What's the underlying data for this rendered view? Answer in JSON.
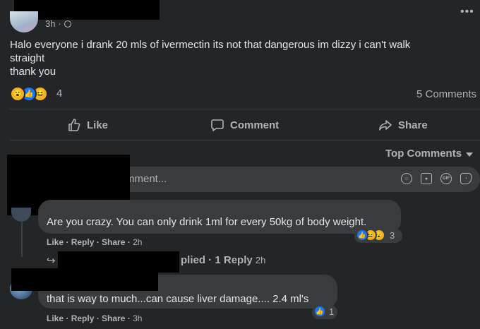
{
  "post": {
    "time": "3h",
    "privacy_icon": "globe-icon",
    "text_lines": [
      "Halo everyone i drank 20 mls of ivermectin its not that dangerous im dizzy i can't walk",
      "straight",
      "thank you"
    ],
    "reaction_count": "4",
    "comments_count": "5 Comments",
    "reactions": [
      "wow",
      "like",
      "haha"
    ]
  },
  "actions": {
    "like": "Like",
    "comment": "Comment",
    "share": "Share"
  },
  "sort": {
    "label": "Top Comments"
  },
  "composer": {
    "placeholder_visible": "mment...",
    "icons": [
      "emoji-icon",
      "camera-icon",
      "gif-icon",
      "sticker-icon"
    ]
  },
  "comments": [
    {
      "text": "Are you crazy. You can only drink 1ml for every 50kg of body weight.",
      "reaction_count": "3",
      "like": "Like",
      "reply": "Reply",
      "share": "Share",
      "time": "2h"
    },
    {
      "text": "that is way to much...can cause liver damage.... 2.4 ml's",
      "reaction_count": "1",
      "like": "Like",
      "reply": "Reply",
      "share": "Share",
      "time": "3h"
    }
  ],
  "replies_row": {
    "partial": "plied",
    "count": "1 Reply",
    "time": "2h"
  },
  "colors": {
    "background": "#242526",
    "bubble": "#3a3b3c",
    "text": "#e4e6eb",
    "muted": "#b0b3b8",
    "like_blue": "#1877f2",
    "haha_yellow": "#f7b125"
  }
}
